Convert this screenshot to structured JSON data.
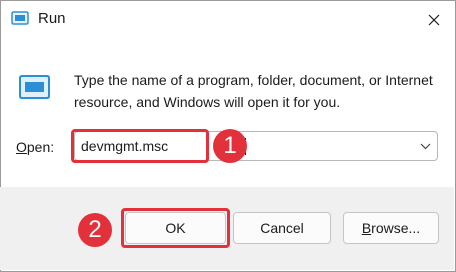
{
  "window": {
    "title": "Run"
  },
  "description": "Type the name of a program, folder, document, or Internet resource, and Windows will open it for you.",
  "open_field": {
    "label_mnemonic": "O",
    "label_rest": "pen:",
    "value": "devmgmt.msc"
  },
  "buttons": {
    "ok": "OK",
    "cancel": "Cancel",
    "browse_mnemonic": "B",
    "browse_rest": "rowse..."
  },
  "annotations": {
    "step1": "1",
    "step2": "2"
  },
  "colors": {
    "highlight": "#e2313a",
    "footer": "#f0f0f0",
    "icon_blue": "#2b8fd6"
  },
  "icons": [
    "run-app-icon",
    "close-icon",
    "run-program-icon",
    "chevron-down-icon"
  ]
}
